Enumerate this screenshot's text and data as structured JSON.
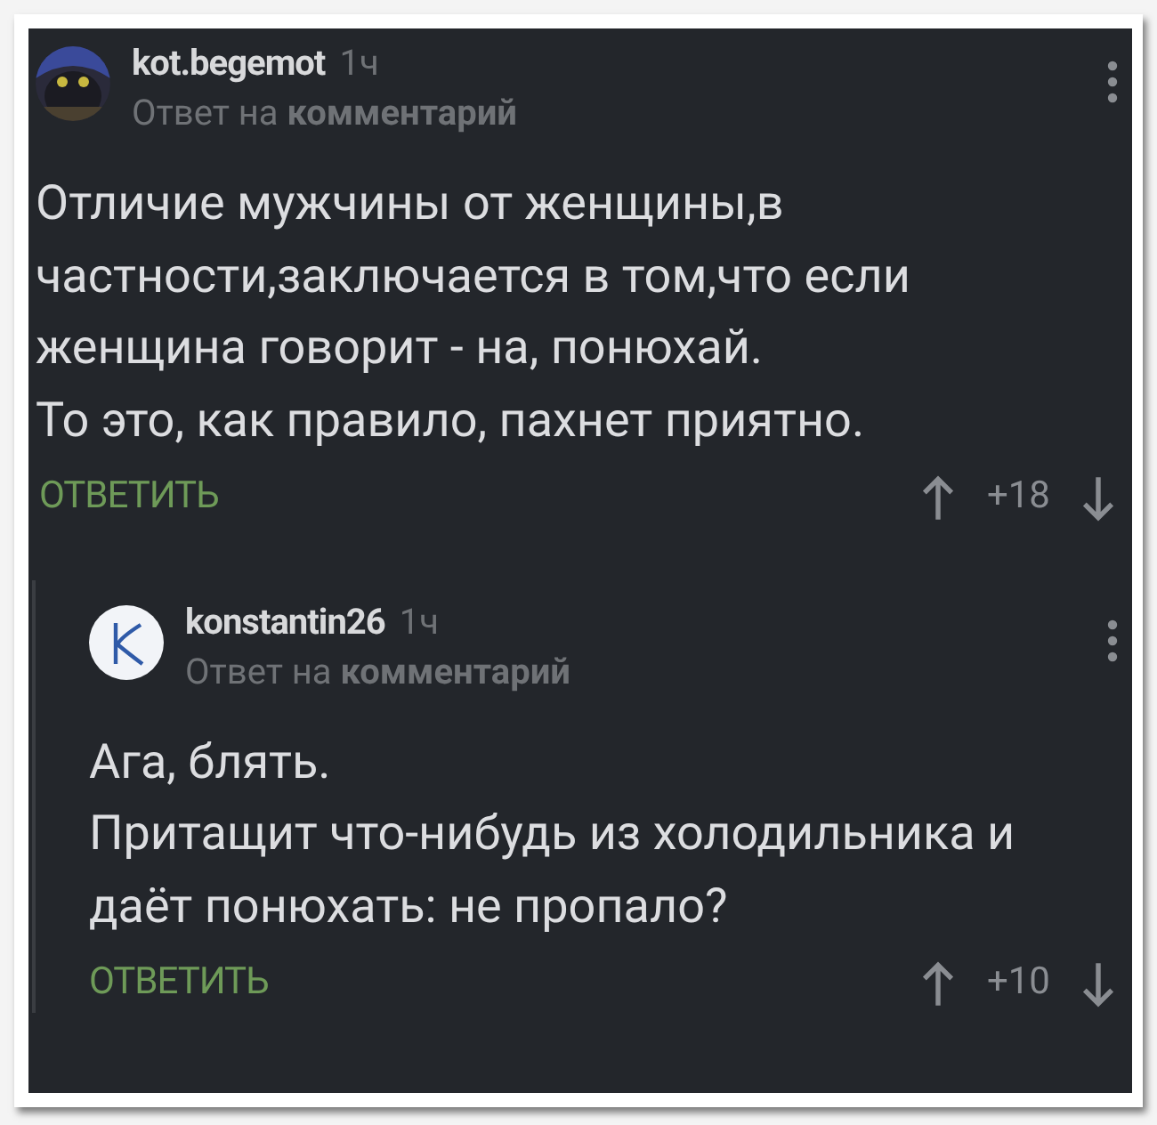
{
  "comments": [
    {
      "author": "kot.begemot",
      "time": "1ч",
      "reply_to": "Ответ на **комментарий**",
      "nested": false,
      "lines": [
        "Отличие мужчины от женщины,в",
        "частности,заключается в том,что если",
        "женщина говорит - на, понюхай.",
        "То это, как правило, пахнет приятно."
      ],
      "reply_button": "ОТВЕТИТЬ",
      "score": "+18"
    },
    {
      "author": "konstantin26",
      "time": "1ч",
      "reply_to": "Ответ на **комментарий**",
      "avatar": {
        "kind": "letter-logo"
      },
      "nested": true,
      "lines": [
        "Ага, блять.",
        "Притащит что-нибудь из холодильника и",
        "даёт понюхать: не пропало?"
      ],
      "reply_button": "ОТВЕТИТЬ",
      "score": "+10"
    }
  ]
}
